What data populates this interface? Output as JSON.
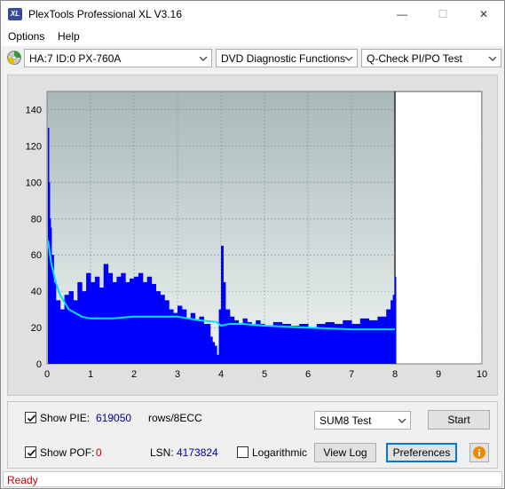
{
  "window": {
    "title": "PlexTools Professional XL V3.16",
    "app_icon_text": "XL",
    "minimize_glyph": "—",
    "maximize_glyph": "☐",
    "close_glyph": "✕"
  },
  "menu": {
    "options": "Options",
    "help": "Help"
  },
  "toolbar": {
    "drive": "HA:7 ID:0  PX-760A",
    "function": "DVD Diagnostic Functions",
    "test": "Q-Check PI/PO Test"
  },
  "chart_data": {
    "type": "bar",
    "title": "",
    "xlabel": "",
    "ylabel": "",
    "xlim": [
      0,
      10
    ],
    "ylim": [
      0,
      150
    ],
    "x_ticks": [
      "0",
      "1",
      "2",
      "3",
      "4",
      "5",
      "6",
      "7",
      "8",
      "9",
      "10"
    ],
    "y_ticks": [
      "0",
      "20",
      "40",
      "60",
      "80",
      "100",
      "120",
      "140"
    ],
    "grid": true,
    "test_end_position": 8,
    "colors": {
      "bars": "#0000ff",
      "line": "#00e0ff",
      "plot_bg_top": "#a8b8b8",
      "plot_bg_bottom": "#f0f4f4"
    },
    "series": [
      {
        "kind": "bars",
        "x": [
          0.02,
          0.04,
          0.06,
          0.08,
          0.1,
          0.15,
          0.2,
          0.3,
          0.4,
          0.5,
          0.6,
          0.7,
          0.8,
          0.9,
          1.0,
          1.1,
          1.2,
          1.3,
          1.4,
          1.5,
          1.6,
          1.7,
          1.8,
          1.9,
          2.0,
          2.1,
          2.2,
          2.3,
          2.4,
          2.5,
          2.6,
          2.7,
          2.8,
          2.9,
          3.0,
          3.1,
          3.2,
          3.3,
          3.4,
          3.5,
          3.6,
          3.7,
          3.75,
          3.8,
          3.85,
          3.9,
          3.95,
          4.0,
          4.05,
          4.1,
          4.2,
          4.3,
          4.4,
          4.5,
          4.6,
          4.7,
          4.8,
          4.9,
          5.0,
          5.2,
          5.4,
          5.6,
          5.8,
          6.0,
          6.2,
          6.4,
          6.6,
          6.8,
          7.0,
          7.2,
          7.4,
          7.6,
          7.8,
          7.9,
          7.95,
          8.0
        ],
        "values": [
          130,
          100,
          80,
          75,
          60,
          45,
          35,
          30,
          38,
          40,
          35,
          45,
          40,
          50,
          45,
          48,
          42,
          55,
          50,
          45,
          48,
          50,
          45,
          47,
          48,
          50,
          45,
          48,
          44,
          40,
          38,
          35,
          30,
          28,
          32,
          30,
          25,
          28,
          24,
          26,
          22,
          22,
          15,
          12,
          10,
          5,
          30,
          65,
          45,
          30,
          26,
          24,
          22,
          25,
          23,
          22,
          24,
          22,
          21,
          23,
          22,
          21,
          22,
          20,
          22,
          23,
          22,
          24,
          22,
          25,
          24,
          26,
          30,
          35,
          38,
          48
        ]
      },
      {
        "kind": "line",
        "x": [
          0.02,
          0.1,
          0.2,
          0.3,
          0.5,
          0.8,
          1.0,
          1.5,
          2.0,
          2.5,
          3.0,
          3.5,
          3.9,
          4.0,
          4.2,
          4.5,
          5.0,
          6.0,
          7.0,
          8.0
        ],
        "values": [
          68,
          55,
          45,
          38,
          30,
          26,
          25,
          25,
          26,
          26,
          26,
          24,
          23,
          21,
          22,
          22,
          21,
          20,
          19,
          19
        ]
      }
    ]
  },
  "controls": {
    "show_pie_label": "Show PIE:",
    "pie_value": "619050",
    "rows_label": "rows/8ECC",
    "show_pof_label": "Show POF:",
    "pof_value": "0",
    "lsn_label": "LSN:",
    "lsn_value": "4173824",
    "logarithmic_label": "Logarithmic",
    "test_mode": "SUM8 Test",
    "start": "Start",
    "view_log": "View Log",
    "preferences": "Preferences",
    "show_pie_checked": true,
    "show_pof_checked": true,
    "logarithmic_checked": false
  },
  "status": {
    "text": "Ready"
  }
}
